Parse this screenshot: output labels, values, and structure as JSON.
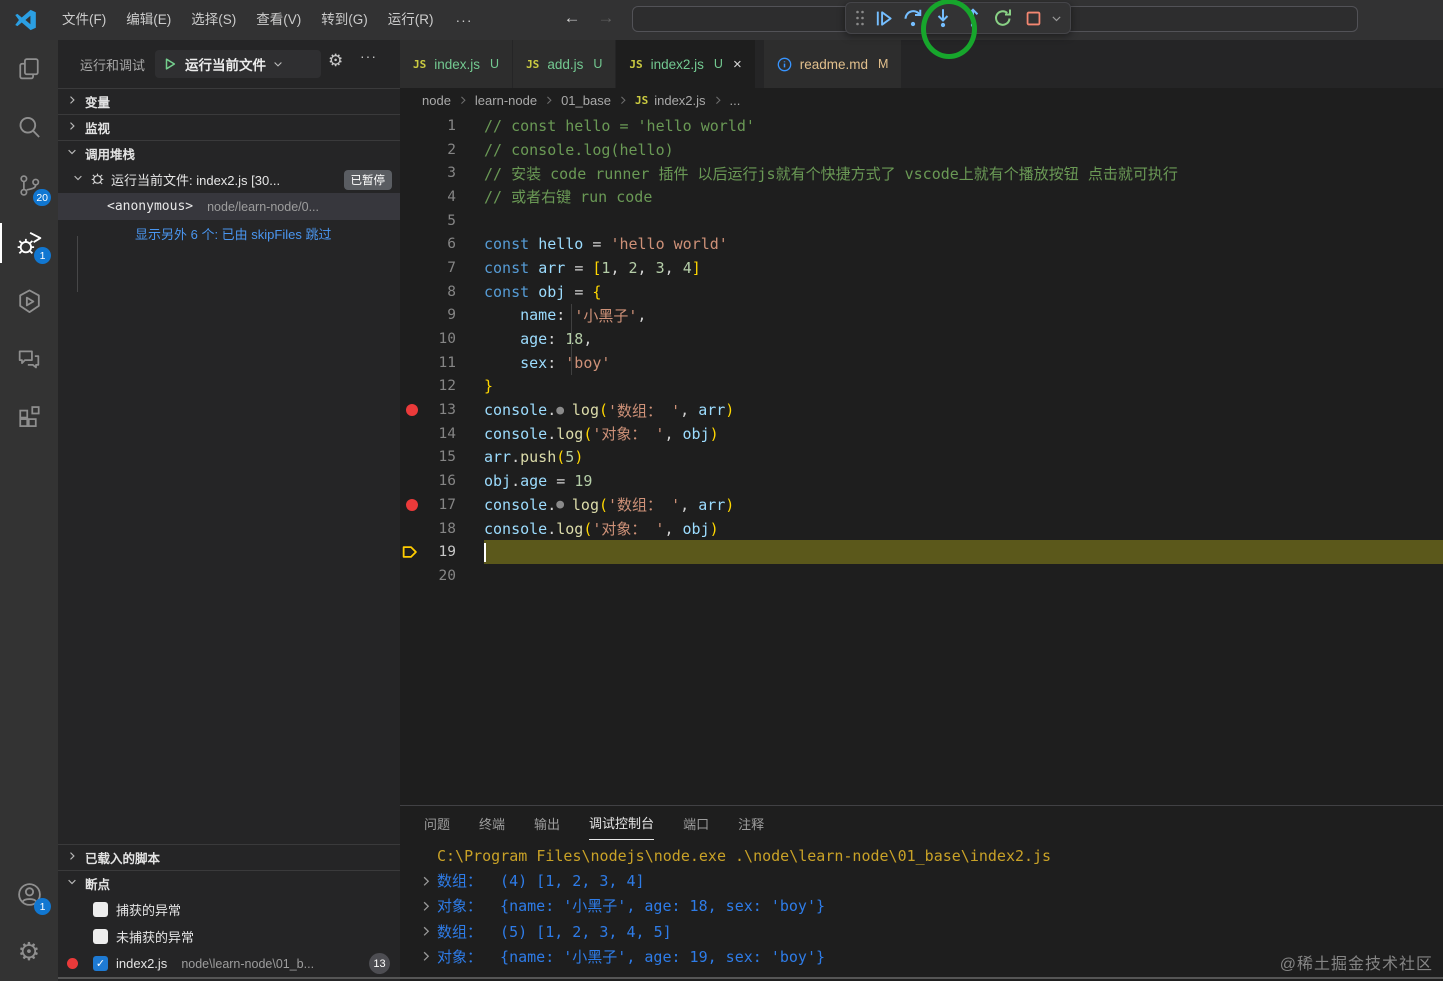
{
  "titlebar": {
    "menus": [
      "文件(F)",
      "编辑(E)",
      "选择(S)",
      "查看(V)",
      "转到(G)",
      "运行(R)"
    ],
    "overflow": "···",
    "back_icon": "←",
    "forward_icon": "→"
  },
  "debug_toolbar": {
    "buttons": [
      {
        "name": "continue"
      },
      {
        "name": "step-over"
      },
      {
        "name": "step-into",
        "annotated": true
      },
      {
        "name": "step-out"
      },
      {
        "name": "restart"
      },
      {
        "name": "stop"
      }
    ],
    "annotation_color": "#17a62c"
  },
  "activity_bar": {
    "top": [
      {
        "name": "explorer"
      },
      {
        "name": "search"
      },
      {
        "name": "source-control",
        "badge": "20"
      },
      {
        "name": "run-and-debug",
        "badge": "1",
        "active": true
      },
      {
        "name": "hexagon-run"
      },
      {
        "name": "comments"
      },
      {
        "name": "extensions"
      }
    ],
    "bottom": [
      {
        "name": "account",
        "badge": "1"
      },
      {
        "name": "settings"
      }
    ]
  },
  "sidebar": {
    "title": "运行和调试",
    "run_config_label": "运行当前文件",
    "more_label": "···",
    "sections_top": [
      {
        "label": "变量"
      },
      {
        "label": "监视"
      }
    ],
    "call_stack": {
      "label": "调用堆栈",
      "session_label": "运行当前文件: index2.js [30...",
      "paused_badge": "已暂停",
      "frame_name": "<anonymous>",
      "frame_path": "node/learn-node/0...",
      "skip_link": "显示另外 6 个: 已由 skipFiles 跳过"
    },
    "loaded_scripts_label": "已载入的脚本",
    "breakpoints": {
      "label": "断点",
      "items": [
        {
          "label": "捕获的异常",
          "checked": false
        },
        {
          "label": "未捕获的异常",
          "checked": false
        },
        {
          "label": "index2.js",
          "path": "node\\learn-node\\01_b...",
          "checked": true,
          "dot": true,
          "badge": "13"
        }
      ]
    }
  },
  "editor": {
    "tabs": [
      {
        "icon": "js",
        "label": "index.js",
        "badge": "U",
        "state": "untracked",
        "active": false
      },
      {
        "icon": "js",
        "label": "add.js",
        "badge": "U",
        "state": "untracked",
        "active": false
      },
      {
        "icon": "js",
        "label": "index2.js",
        "badge": "U",
        "state": "untracked",
        "active": true,
        "close": "×"
      },
      {
        "icon": "info",
        "label": "readme.md",
        "badge": "M",
        "state": "modified",
        "active": false,
        "gap": true
      }
    ],
    "breadcrumb": [
      {
        "label": "node"
      },
      {
        "label": "learn-node"
      },
      {
        "label": "01_base"
      },
      {
        "label": "index2.js",
        "icon": "js"
      },
      {
        "label": "..."
      }
    ],
    "code_lines": [
      {
        "n": 1,
        "tokens": [
          [
            "cm",
            "// const hello = 'hello world'"
          ]
        ]
      },
      {
        "n": 2,
        "tokens": [
          [
            "cm",
            "// console.log(hello)"
          ]
        ]
      },
      {
        "n": 3,
        "tokens": [
          [
            "cm",
            "// 安装 code runner 插件 以后运行js就有个快捷方式了 vscode上就有个播放按钮 点击就可执行"
          ]
        ]
      },
      {
        "n": 4,
        "tokens": [
          [
            "cm",
            "// 或者右键 run code"
          ]
        ]
      },
      {
        "n": 5,
        "tokens": []
      },
      {
        "n": 6,
        "tokens": [
          [
            "kw",
            "const "
          ],
          [
            "vr",
            "hello "
          ],
          [
            "pn",
            "= "
          ],
          [
            "st",
            "'hello world'"
          ]
        ]
      },
      {
        "n": 7,
        "tokens": [
          [
            "kw",
            "const "
          ],
          [
            "vr",
            "arr "
          ],
          [
            "pn",
            "= "
          ],
          [
            "br",
            "["
          ],
          [
            "nm",
            "1"
          ],
          [
            "pn",
            ", "
          ],
          [
            "nm",
            "2"
          ],
          [
            "pn",
            ", "
          ],
          [
            "nm",
            "3"
          ],
          [
            "pn",
            ", "
          ],
          [
            "nm",
            "4"
          ],
          [
            "br",
            "]"
          ]
        ]
      },
      {
        "n": 8,
        "tokens": [
          [
            "kw",
            "const "
          ],
          [
            "vr",
            "obj "
          ],
          [
            "pn",
            "= "
          ],
          [
            "br",
            "{"
          ]
        ]
      },
      {
        "n": 9,
        "guide": true,
        "tokens": [
          [
            "pn",
            "    "
          ],
          [
            "vr",
            "name"
          ],
          [
            "pn",
            ": "
          ],
          [
            "st",
            "'小黑子'"
          ],
          [
            "pn",
            ","
          ]
        ]
      },
      {
        "n": 10,
        "guide": true,
        "tokens": [
          [
            "pn",
            "    "
          ],
          [
            "vr",
            "age"
          ],
          [
            "pn",
            ": "
          ],
          [
            "nm",
            "18"
          ],
          [
            "pn",
            ","
          ]
        ]
      },
      {
        "n": 11,
        "guide": true,
        "tokens": [
          [
            "pn",
            "    "
          ],
          [
            "vr",
            "sex"
          ],
          [
            "pn",
            ": "
          ],
          [
            "st",
            "'boy'"
          ]
        ]
      },
      {
        "n": 12,
        "tokens": [
          [
            "br",
            "}"
          ]
        ]
      },
      {
        "n": 13,
        "bp": true,
        "tokens": [
          [
            "vr",
            "console"
          ],
          [
            "pn",
            "."
          ],
          [
            "bp",
            "● "
          ],
          [
            "fn",
            "log"
          ],
          [
            "br",
            "("
          ],
          [
            "st",
            "'数组： '"
          ],
          [
            "pn",
            ", "
          ],
          [
            "vr",
            "arr"
          ],
          [
            "br",
            ")"
          ]
        ]
      },
      {
        "n": 14,
        "tokens": [
          [
            "vr",
            "console"
          ],
          [
            "pn",
            "."
          ],
          [
            "fn",
            "log"
          ],
          [
            "br",
            "("
          ],
          [
            "st",
            "'对象： '"
          ],
          [
            "pn",
            ", "
          ],
          [
            "vr",
            "obj"
          ],
          [
            "br",
            ")"
          ]
        ]
      },
      {
        "n": 15,
        "tokens": [
          [
            "vr",
            "arr"
          ],
          [
            "pn",
            "."
          ],
          [
            "fn",
            "push"
          ],
          [
            "br",
            "("
          ],
          [
            "nm",
            "5"
          ],
          [
            "br",
            ")"
          ]
        ]
      },
      {
        "n": 16,
        "tokens": [
          [
            "vr",
            "obj"
          ],
          [
            "pn",
            "."
          ],
          [
            "vr",
            "age"
          ],
          [
            "pn",
            " = "
          ],
          [
            "nm",
            "19"
          ]
        ]
      },
      {
        "n": 17,
        "bp": true,
        "tokens": [
          [
            "vr",
            "console"
          ],
          [
            "pn",
            "."
          ],
          [
            "bp",
            "● "
          ],
          [
            "fn",
            "log"
          ],
          [
            "br",
            "("
          ],
          [
            "st",
            "'数组： '"
          ],
          [
            "pn",
            ", "
          ],
          [
            "vr",
            "arr"
          ],
          [
            "br",
            ")"
          ]
        ]
      },
      {
        "n": 18,
        "tokens": [
          [
            "vr",
            "console"
          ],
          [
            "pn",
            "."
          ],
          [
            "fn",
            "log"
          ],
          [
            "br",
            "("
          ],
          [
            "st",
            "'对象： '"
          ],
          [
            "pn",
            ", "
          ],
          [
            "vr",
            "obj"
          ],
          [
            "br",
            ")"
          ]
        ]
      },
      {
        "n": 19,
        "current": true,
        "tokens": []
      },
      {
        "n": 20,
        "tokens": []
      }
    ]
  },
  "panel": {
    "tabs": [
      {
        "label": "问题",
        "active": false
      },
      {
        "label": "终端",
        "active": false
      },
      {
        "label": "输出",
        "active": false
      },
      {
        "label": "调试控制台",
        "active": true
      },
      {
        "label": "端口",
        "active": false
      },
      {
        "label": "注释",
        "active": false
      }
    ],
    "console": [
      {
        "type": "cmd",
        "chevron": false,
        "text": "C:\\Program Files\\nodejs\\node.exe .\\node\\learn-node\\01_base\\index2.js"
      },
      {
        "type": "log",
        "chevron": true,
        "text": "数组：  (4) [1, 2, 3, 4]"
      },
      {
        "type": "log",
        "chevron": true,
        "text": "对象：  {name: '小黑子', age: 18, sex: 'boy'}"
      },
      {
        "type": "log",
        "chevron": true,
        "text": "数组：  (5) [1, 2, 3, 4, 5]"
      },
      {
        "type": "log",
        "chevron": true,
        "text": "对象：  {name: '小黑子', age: 19, sex: 'boy'}"
      }
    ]
  },
  "watermark": "@稀土掘金技术社区",
  "colors": {
    "badge_blue": "#1177d1",
    "breakpoint_red": "#eb3a3a",
    "current_line": "#5b581b",
    "untracked_green": "#73c991",
    "modified_orange": "#e2c08d",
    "console_blue": "#2e7ce8",
    "console_cmd_yellow": "#c9a227",
    "annotation_green": "#17a62c"
  }
}
